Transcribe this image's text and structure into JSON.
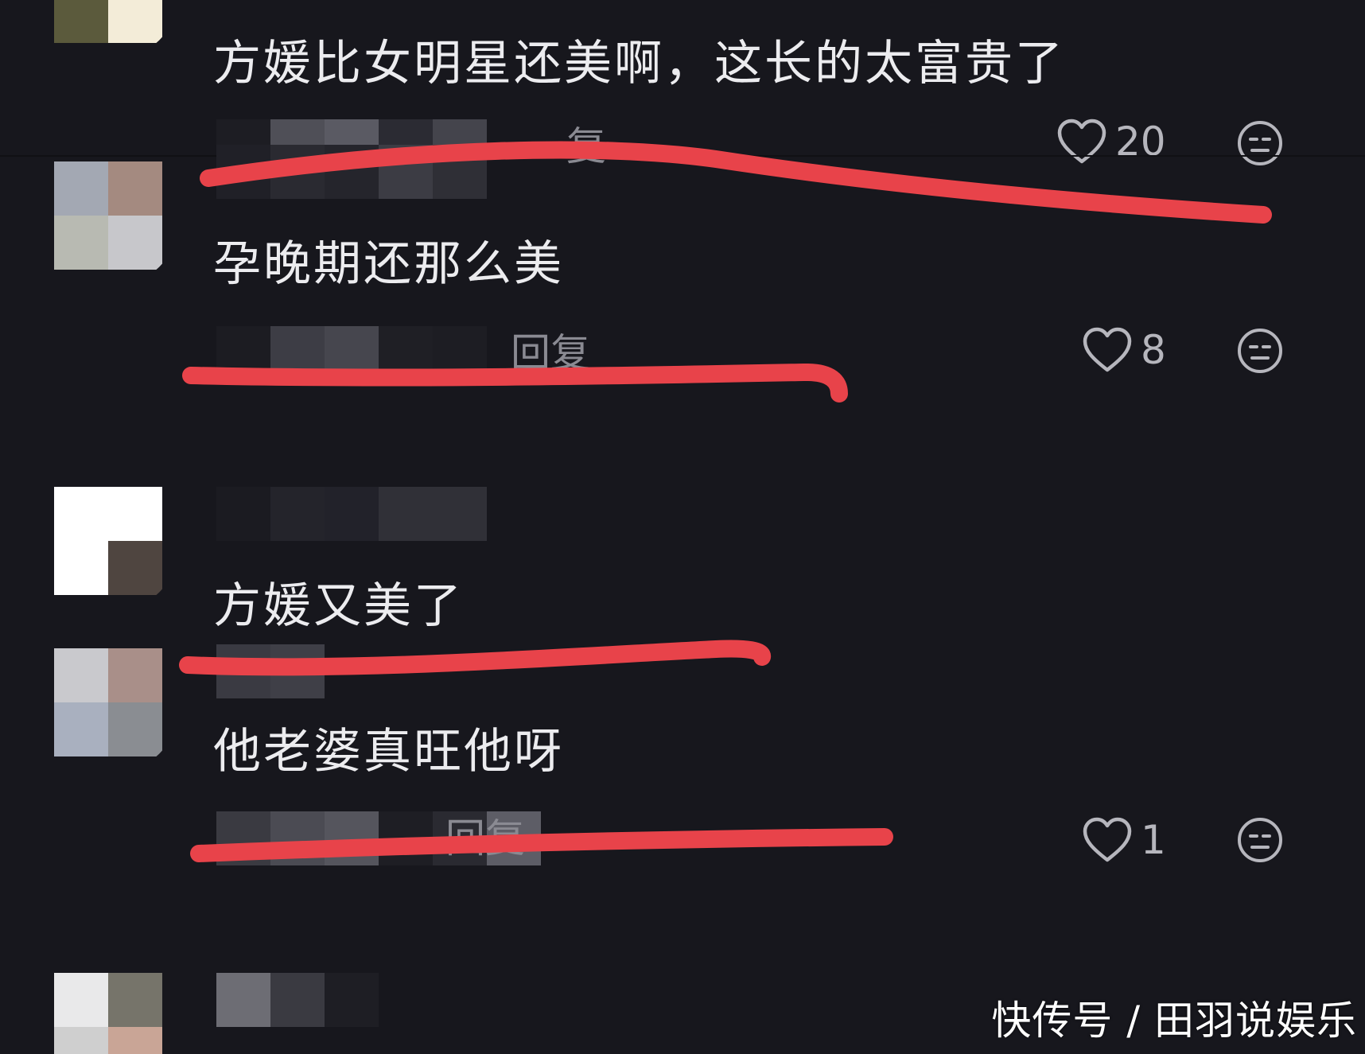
{
  "comments": [
    {
      "text": "方媛比女明星还美啊，这长的太富贵了",
      "reply_label": "复",
      "likes": "20"
    },
    {
      "text": "孕晚期还那么美",
      "reply_label": "回复",
      "likes": "8"
    },
    {
      "text": "方媛又美了",
      "reply_label": "",
      "likes": ""
    },
    {
      "text": "他老婆真旺他呀",
      "reply_label": "回复",
      "likes": "1"
    },
    {
      "text": "",
      "reply_label": "",
      "likes": ""
    }
  ],
  "icons": {
    "like": "heart-outline-icon",
    "dislike": "neutral-face-icon"
  },
  "colors": {
    "background": "#17171d",
    "text": "#ececef",
    "annotation_red": "#e8434a",
    "icon": "#b6b6bd"
  },
  "watermark": "快传号 / 田羽说娱乐"
}
